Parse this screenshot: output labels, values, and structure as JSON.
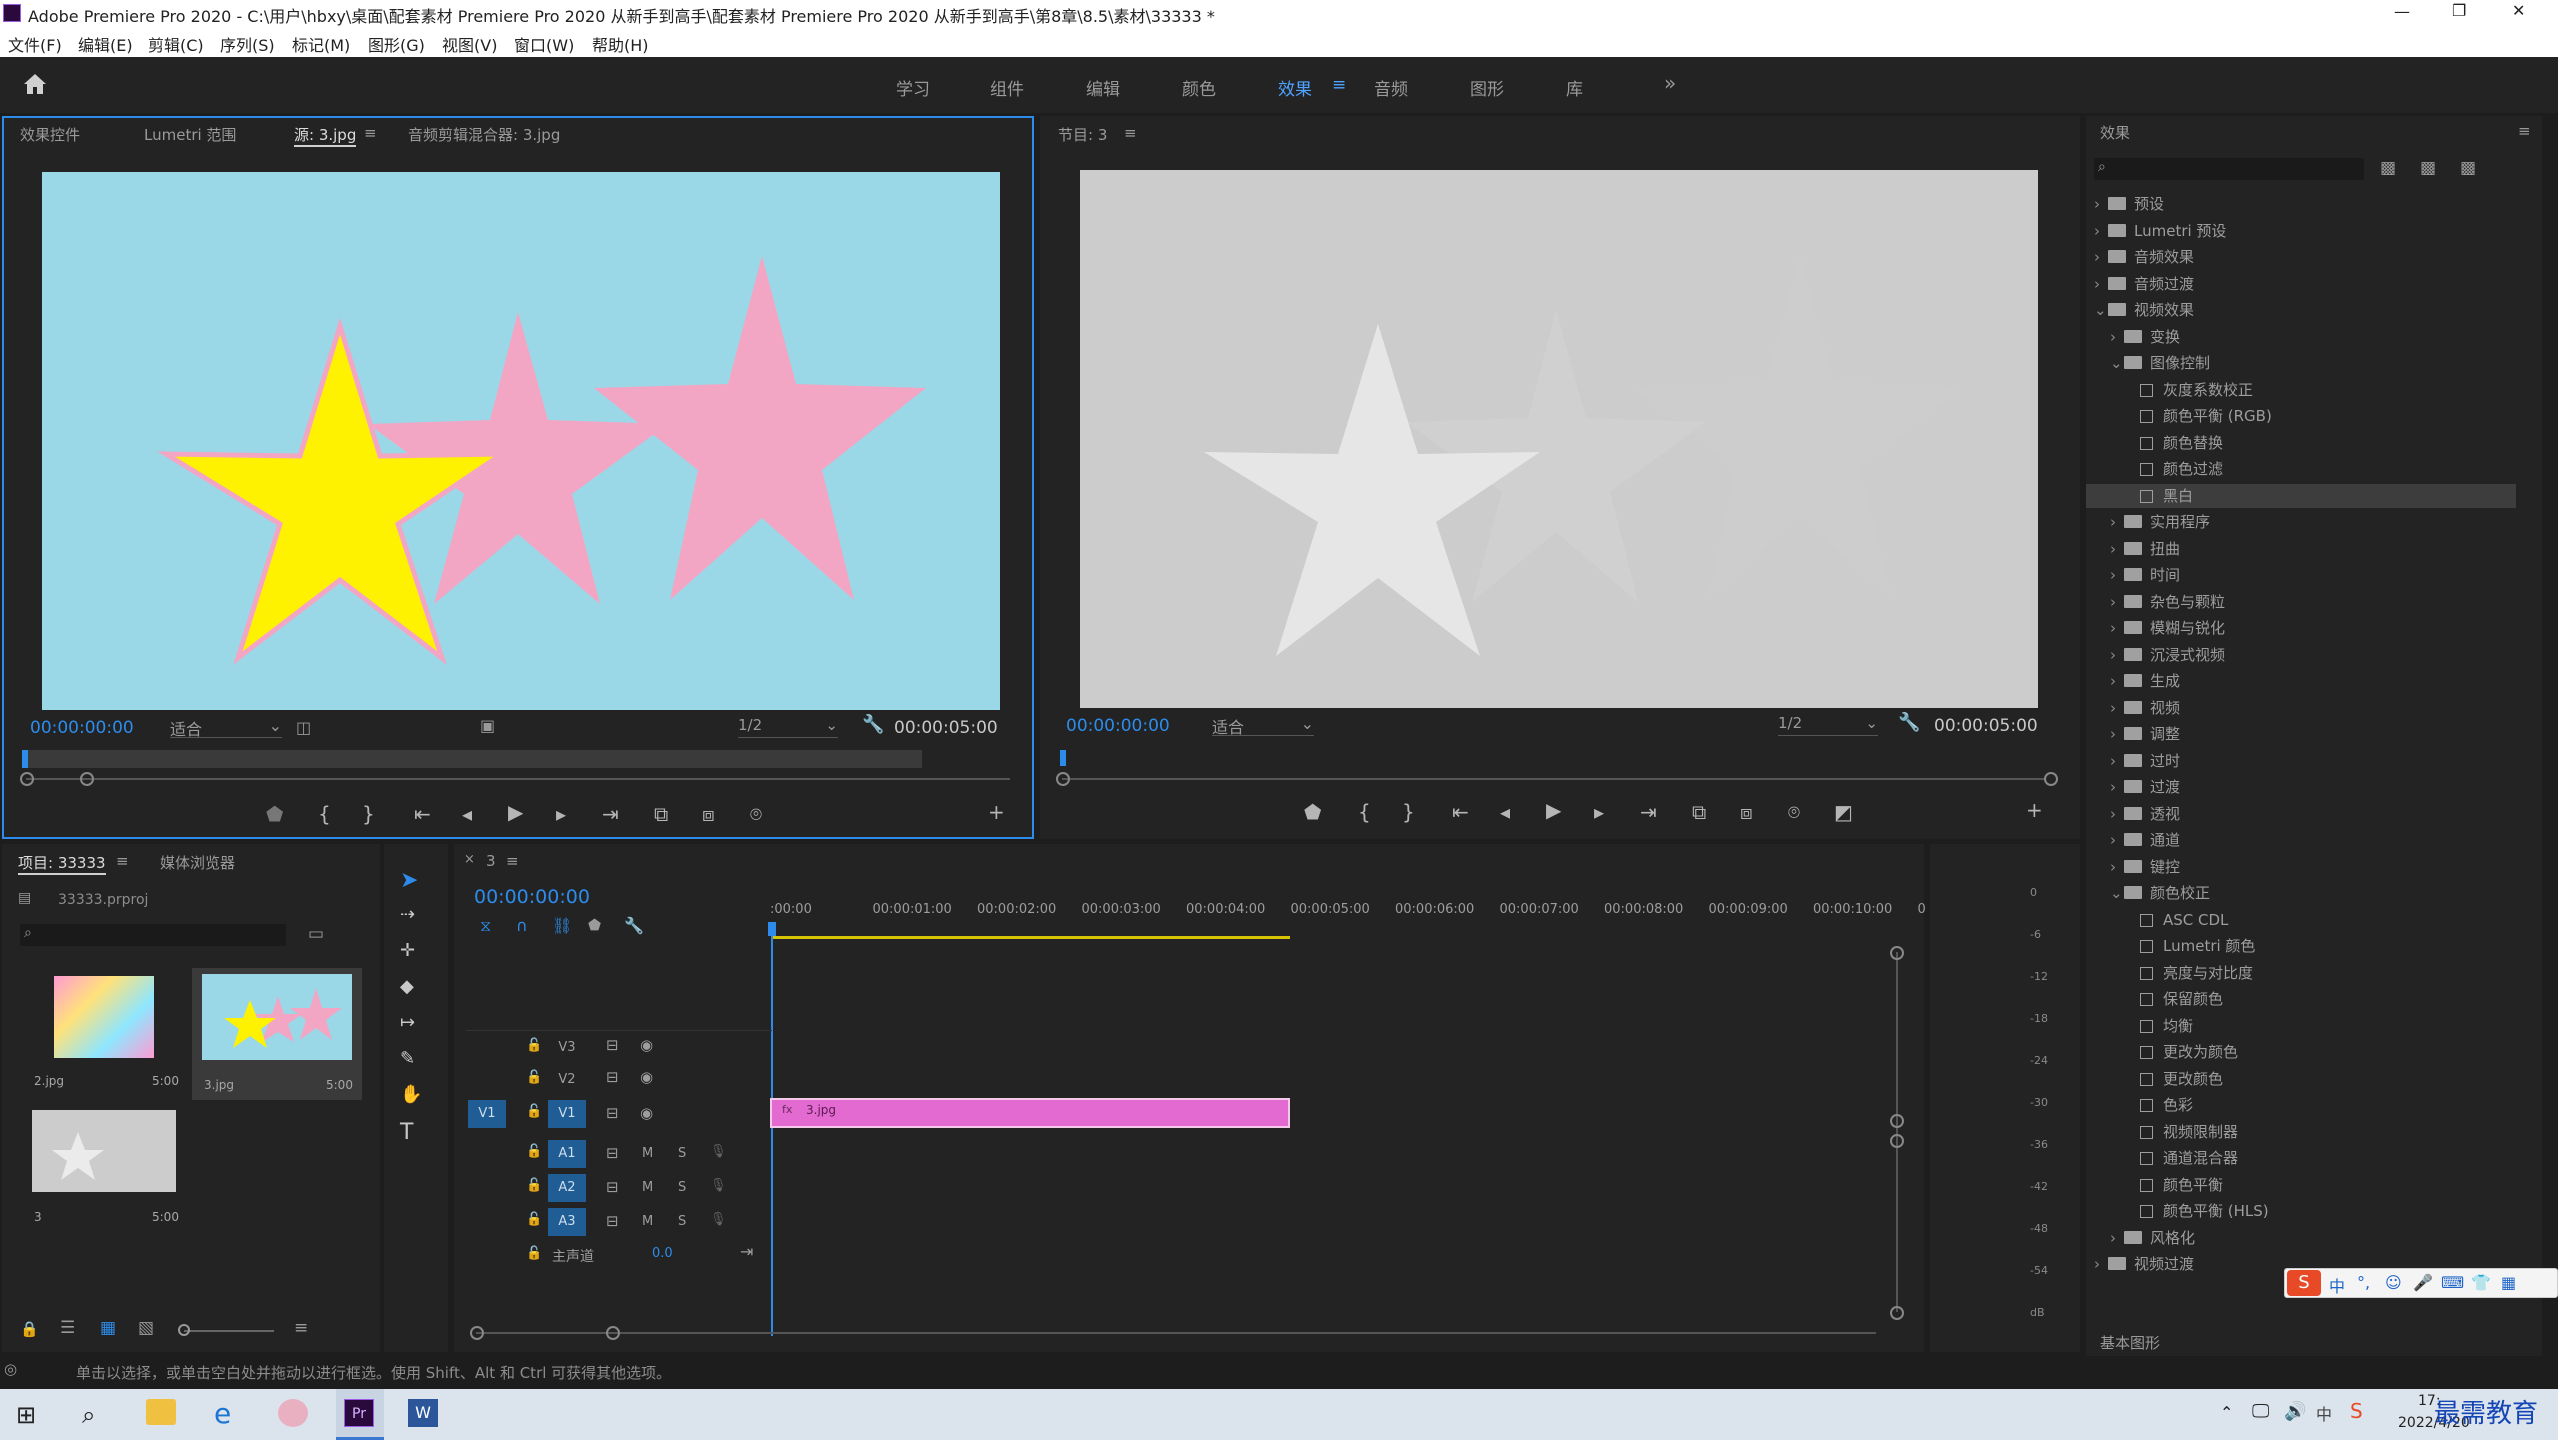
{
  "window": {
    "title": "Adobe Premiere Pro 2020 - C:\\用户\\hbxy\\桌面\\配套素材 Premiere Pro 2020 从新手到高手\\配套素材 Premiere Pro 2020 从新手到高手\\第8章\\8.5\\素材\\33333 *",
    "minimize": "—",
    "restore": "❐",
    "close": "✕"
  },
  "menu": [
    "文件(F)",
    "编辑(E)",
    "剪辑(C)",
    "序列(S)",
    "标记(M)",
    "图形(G)",
    "视图(V)",
    "窗口(W)",
    "帮助(H)"
  ],
  "workspaces": {
    "items": [
      "学习",
      "组件",
      "编辑",
      "颜色",
      "效果",
      "音频",
      "图形",
      "库"
    ],
    "active": "效果",
    "more": "»"
  },
  "source_panel": {
    "tabs": [
      "效果控件",
      "Lumetri 范围",
      "源: 3.jpg",
      "音频剪辑混合器: 3.jpg"
    ],
    "timecode": "00:00:00:00",
    "fit": "适合",
    "resolution": "1/2",
    "duration": "00:00:05:00"
  },
  "program_panel": {
    "tab": "节目: 3",
    "timecode": "00:00:00:00",
    "fit": "适合",
    "resolution": "1/2",
    "duration": "00:00:05:00"
  },
  "effects_panel": {
    "title": "效果",
    "search_placeholder": "",
    "tree": [
      {
        "label": "预设",
        "level": 0,
        "type": "folder",
        "open": false
      },
      {
        "label": "Lumetri 预设",
        "level": 0,
        "type": "folder",
        "open": false
      },
      {
        "label": "音频效果",
        "level": 0,
        "type": "folder",
        "open": false
      },
      {
        "label": "音频过渡",
        "level": 0,
        "type": "folder",
        "open": false
      },
      {
        "label": "视频效果",
        "level": 0,
        "type": "folder",
        "open": true
      },
      {
        "label": "变换",
        "level": 1,
        "type": "folder",
        "open": false
      },
      {
        "label": "图像控制",
        "level": 1,
        "type": "folder",
        "open": true
      },
      {
        "label": "灰度系数校正",
        "level": 2,
        "type": "fx"
      },
      {
        "label": "颜色平衡 (RGB)",
        "level": 2,
        "type": "fx"
      },
      {
        "label": "颜色替换",
        "level": 2,
        "type": "fx"
      },
      {
        "label": "颜色过滤",
        "level": 2,
        "type": "fx"
      },
      {
        "label": "黑白",
        "level": 2,
        "type": "fx",
        "selected": true
      },
      {
        "label": "实用程序",
        "level": 1,
        "type": "folder",
        "open": false
      },
      {
        "label": "扭曲",
        "level": 1,
        "type": "folder",
        "open": false
      },
      {
        "label": "时间",
        "level": 1,
        "type": "folder",
        "open": false
      },
      {
        "label": "杂色与颗粒",
        "level": 1,
        "type": "folder",
        "open": false
      },
      {
        "label": "模糊与锐化",
        "level": 1,
        "type": "folder",
        "open": false
      },
      {
        "label": "沉浸式视频",
        "level": 1,
        "type": "folder",
        "open": false
      },
      {
        "label": "生成",
        "level": 1,
        "type": "folder",
        "open": false
      },
      {
        "label": "视频",
        "level": 1,
        "type": "folder",
        "open": false
      },
      {
        "label": "调整",
        "level": 1,
        "type": "folder",
        "open": false
      },
      {
        "label": "过时",
        "level": 1,
        "type": "folder",
        "open": false
      },
      {
        "label": "过渡",
        "level": 1,
        "type": "folder",
        "open": false
      },
      {
        "label": "透视",
        "level": 1,
        "type": "folder",
        "open": false
      },
      {
        "label": "通道",
        "level": 1,
        "type": "folder",
        "open": false
      },
      {
        "label": "键控",
        "level": 1,
        "type": "folder",
        "open": false
      },
      {
        "label": "颜色校正",
        "level": 1,
        "type": "folder",
        "open": true
      },
      {
        "label": "ASC CDL",
        "level": 2,
        "type": "fx"
      },
      {
        "label": "Lumetri 颜色",
        "level": 2,
        "type": "fx"
      },
      {
        "label": "亮度与对比度",
        "level": 2,
        "type": "fx"
      },
      {
        "label": "保留颜色",
        "level": 2,
        "type": "fx"
      },
      {
        "label": "均衡",
        "level": 2,
        "type": "fx"
      },
      {
        "label": "更改为颜色",
        "level": 2,
        "type": "fx"
      },
      {
        "label": "更改颜色",
        "level": 2,
        "type": "fx"
      },
      {
        "label": "色彩",
        "level": 2,
        "type": "fx"
      },
      {
        "label": "视频限制器",
        "level": 2,
        "type": "fx"
      },
      {
        "label": "通道混合器",
        "level": 2,
        "type": "fx"
      },
      {
        "label": "颜色平衡",
        "level": 2,
        "type": "fx"
      },
      {
        "label": "颜色平衡 (HLS)",
        "level": 2,
        "type": "fx"
      },
      {
        "label": "风格化",
        "level": 1,
        "type": "folder",
        "open": false
      },
      {
        "label": "视频过渡",
        "level": 0,
        "type": "folder",
        "open": false
      }
    ],
    "basic_graphics": "基本图形"
  },
  "project_panel": {
    "tabs": [
      "项目: 33333",
      "媒体浏览器"
    ],
    "file": "33333.prproj",
    "items": [
      {
        "name": "2.jpg",
        "dur": "5:00"
      },
      {
        "name": "3.jpg",
        "dur": "5:00"
      },
      {
        "name": "3",
        "dur": "5:00"
      }
    ]
  },
  "timeline": {
    "sequence": "3",
    "timecode": "00:00:00:00",
    "ruler": [
      ":00:00",
      "00:00:01:00",
      "00:00:02:00",
      "00:00:03:00",
      "00:00:04:00",
      "00:00:05:00",
      "00:00:06:00",
      "00:00:07:00",
      "00:00:08:00",
      "00:00:09:00",
      "00:00:10:00",
      "0"
    ],
    "video_tracks": [
      "V3",
      "V2",
      "V1"
    ],
    "audio_tracks": [
      "A1",
      "A2",
      "A3"
    ],
    "src_v": "V1",
    "mute": "M",
    "solo": "S",
    "master_label": "主声道",
    "master_value": "0.0",
    "clip": "3.jpg",
    "clip_fx": "fx"
  },
  "meter": {
    "labels": [
      "0",
      "-6",
      "-12",
      "-18",
      "-24",
      "-30",
      "-36",
      "-42",
      "-48",
      "-54",
      "dB"
    ]
  },
  "status": "单击以选择，或单击空白处并拖动以进行框选。使用 Shift、Alt 和 Ctrl 可获得其他选项。",
  "taskbar": {
    "time": "17:",
    "date": "2022/4/20",
    "watermark": "最需教育"
  }
}
